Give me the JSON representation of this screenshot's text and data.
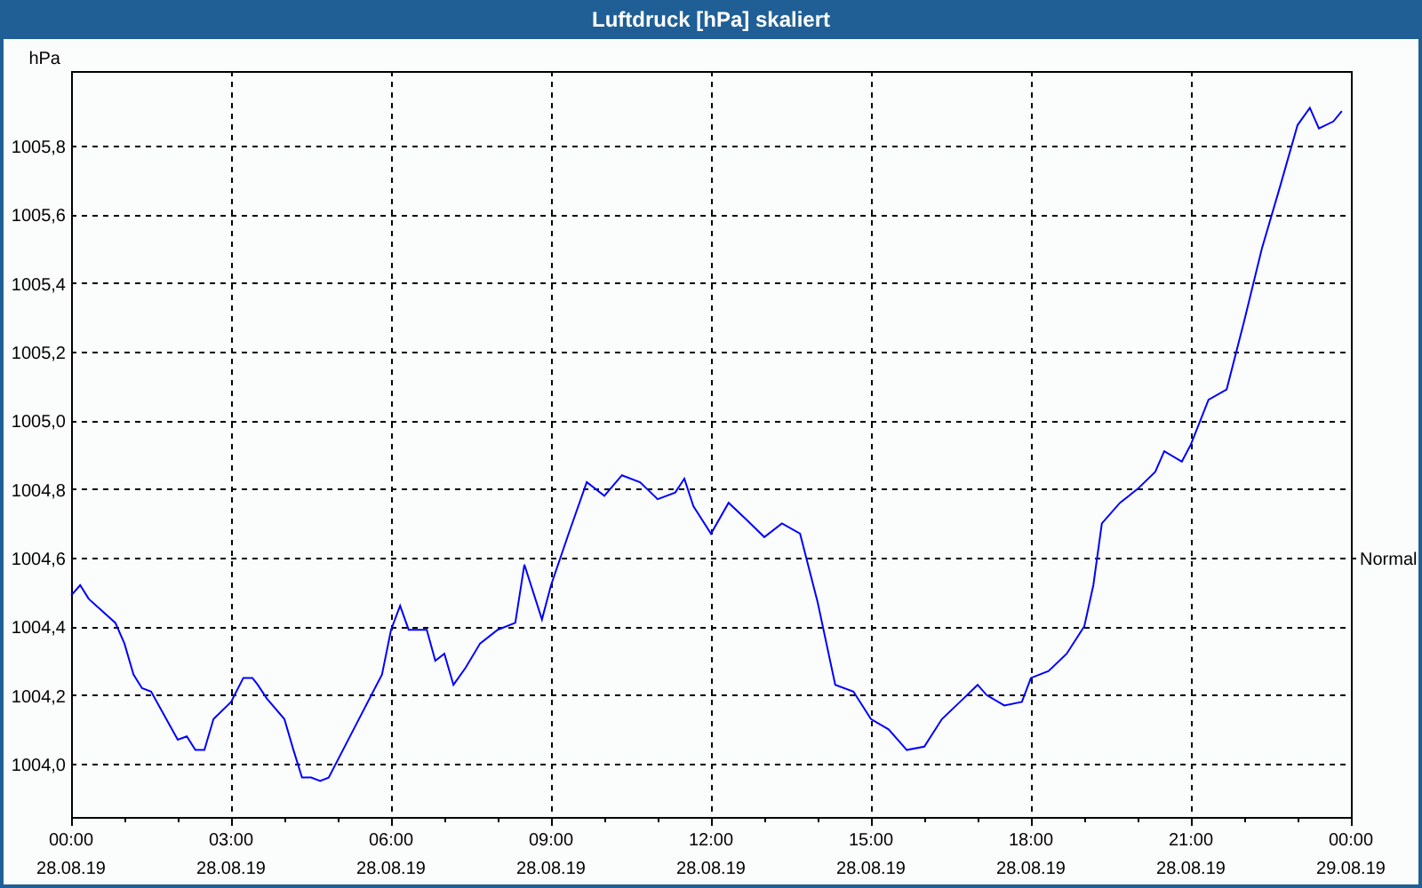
{
  "window": {
    "title": "Luftdruck [hPa] skaliert"
  },
  "chart": {
    "chart_data": {
      "type": "line",
      "ylabel": "hPa",
      "xlim": [
        0,
        24
      ],
      "ylim": [
        1003.845,
        1006.017
      ],
      "grid": true,
      "xticks": [
        {
          "value": 0,
          "label": "00:00"
        },
        {
          "value": 3,
          "label": "03:00"
        },
        {
          "value": 6,
          "label": "06:00"
        },
        {
          "value": 9,
          "label": "09:00"
        },
        {
          "value": 12,
          "label": "12:00"
        },
        {
          "value": 15,
          "label": "15:00"
        },
        {
          "value": 18,
          "label": "18:00"
        },
        {
          "value": 21,
          "label": "21:00"
        },
        {
          "value": 24,
          "label": "00:00"
        }
      ],
      "yticks": [
        {
          "value": 1004.0,
          "label": "1004,0"
        },
        {
          "value": 1004.2,
          "label": "1004,2"
        },
        {
          "value": 1004.4,
          "label": "1004,4"
        },
        {
          "value": 1004.6,
          "label": "1004,6"
        },
        {
          "value": 1004.8,
          "label": "1004,8"
        },
        {
          "value": 1005.0,
          "label": "1005,0"
        },
        {
          "value": 1005.2,
          "label": "1005,2"
        },
        {
          "value": 1005.4,
          "label": "1005,4"
        },
        {
          "value": 1005.6,
          "label": "1005,6"
        },
        {
          "value": 1005.8,
          "label": "1005,8"
        }
      ],
      "annotations": [
        "Normal"
      ],
      "x": [
        0,
        0.17,
        0.33,
        0.83,
        1,
        1.17,
        1.33,
        1.5,
        2,
        2.17,
        2.33,
        2.5,
        2.67,
        3,
        3.23,
        3.4,
        3.5,
        3.67,
        4,
        4.17,
        4.33,
        4.5,
        4.67,
        4.83,
        5.33,
        5.83,
        6,
        6.17,
        6.33,
        6.67,
        6.83,
        7,
        7.17,
        7.4,
        7.67,
        8,
        8.33,
        8.5,
        8.83,
        9,
        9.33,
        9.67,
        10,
        10.33,
        10.67,
        11,
        11.33,
        11.5,
        11.67,
        12,
        12.33,
        12.67,
        13,
        13.33,
        13.67,
        14,
        14.33,
        14.67,
        15,
        15.33,
        15.67,
        16,
        16.33,
        16.67,
        17,
        17.17,
        17.5,
        17.83,
        18,
        18.33,
        18.67,
        19,
        19.17,
        19.33,
        19.67,
        20,
        20.33,
        20.5,
        20.83,
        21,
        21.33,
        21.67,
        22,
        22.33,
        22.67,
        23,
        23.23,
        23.4,
        23.67,
        23.83
      ],
      "series": [
        {
          "color": "#0000ff",
          "values": [
            1004.49,
            1004.52,
            1004.48,
            1004.41,
            1004.35,
            1004.26,
            1004.22,
            1004.21,
            1004.07,
            1004.08,
            1004.04,
            1004.04,
            1004.13,
            1004.18,
            1004.25,
            1004.25,
            1004.23,
            1004.19,
            1004.13,
            1004.04,
            1003.96,
            1003.96,
            1003.95,
            1003.96,
            1004.11,
            1004.26,
            1004.39,
            1004.46,
            1004.39,
            1004.39,
            1004.3,
            1004.32,
            1004.23,
            1004.28,
            1004.35,
            1004.39,
            1004.41,
            1004.58,
            1004.42,
            1004.52,
            1004.67,
            1004.82,
            1004.78,
            1004.84,
            1004.82,
            1004.77,
            1004.79,
            1004.83,
            1004.75,
            1004.67,
            1004.76,
            1004.71,
            1004.66,
            1004.7,
            1004.67,
            1004.47,
            1004.23,
            1004.21,
            1004.13,
            1004.1,
            1004.04,
            1004.05,
            1004.13,
            1004.18,
            1004.23,
            1004.2,
            1004.17,
            1004.18,
            1004.25,
            1004.27,
            1004.32,
            1004.4,
            1004.52,
            1004.7,
            1004.76,
            1004.8,
            1004.85,
            1004.91,
            1004.88,
            1004.93,
            1005.06,
            1005.09,
            1005.29,
            1005.5,
            1005.68,
            1005.86,
            1005.91,
            1005.85,
            1005.87,
            1005.9
          ]
        }
      ]
    },
    "x_dates": [
      "28.08.19",
      "28.08.19",
      "28.08.19",
      "28.08.19",
      "28.08.19",
      "28.08.19",
      "28.08.19",
      "28.08.19",
      "29.08.19"
    ]
  }
}
